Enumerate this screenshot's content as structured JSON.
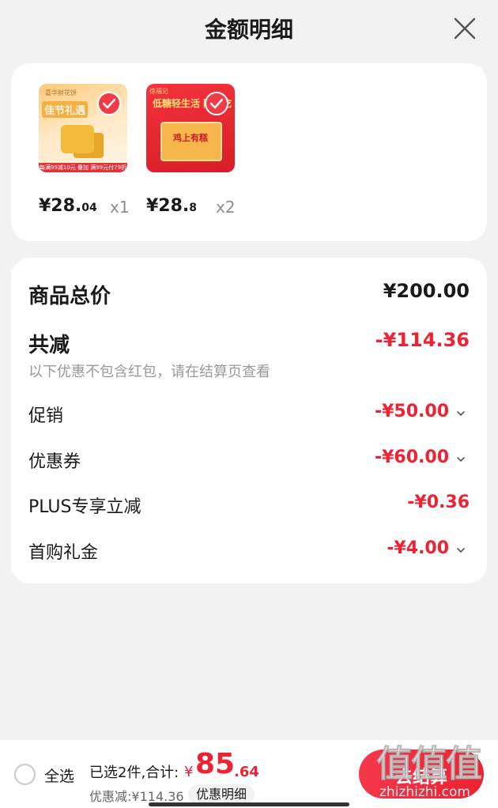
{
  "header": {
    "title": "金额明细"
  },
  "products": [
    {
      "price_int": "¥28.",
      "price_dec": "04",
      "qty": "x1",
      "img_brand": "嘉华鲜花饼",
      "img_title": "佳节礼遇",
      "img_promo": "每满99减10元 叠加 满99元付79折"
    },
    {
      "price_int": "¥28.",
      "price_dec": "8",
      "qty": "x2",
      "img_brand": "徐福记",
      "img_title": "低糖轻生活 随心吃",
      "img_box": "鸡上有糕"
    }
  ],
  "summary": {
    "total_label": "商品总价",
    "total_value": "¥200.00",
    "reduce_label": "共减",
    "reduce_value": "-¥114.36",
    "note": "以下优惠不包含红包，请在结算页查看",
    "items": [
      {
        "label": "促销",
        "value": "-¥50.00"
      },
      {
        "label": "优惠券",
        "value": "-¥60.00"
      },
      {
        "label": "PLUS专享立减",
        "value": "-¥0.36"
      },
      {
        "label": "首购礼金",
        "value": "-¥4.00"
      }
    ]
  },
  "bottom": {
    "select_all": "全选",
    "selected_text": "已选2件,合计:",
    "currency": "¥",
    "total_int": "85",
    "total_dec": ".64",
    "discount_text": "优惠减:¥114.36",
    "detail_label": "优惠明细",
    "checkout_label": "去结算"
  },
  "watermark": {
    "main": "值值值",
    "sub": "zhizhizhi.com"
  },
  "colors": {
    "accent": "#ee2233",
    "background": "#f2f2f2",
    "card": "#ffffff"
  },
  "icons": {
    "close": "close-icon",
    "check": "check-icon",
    "chevron": "chevron-down-icon"
  }
}
